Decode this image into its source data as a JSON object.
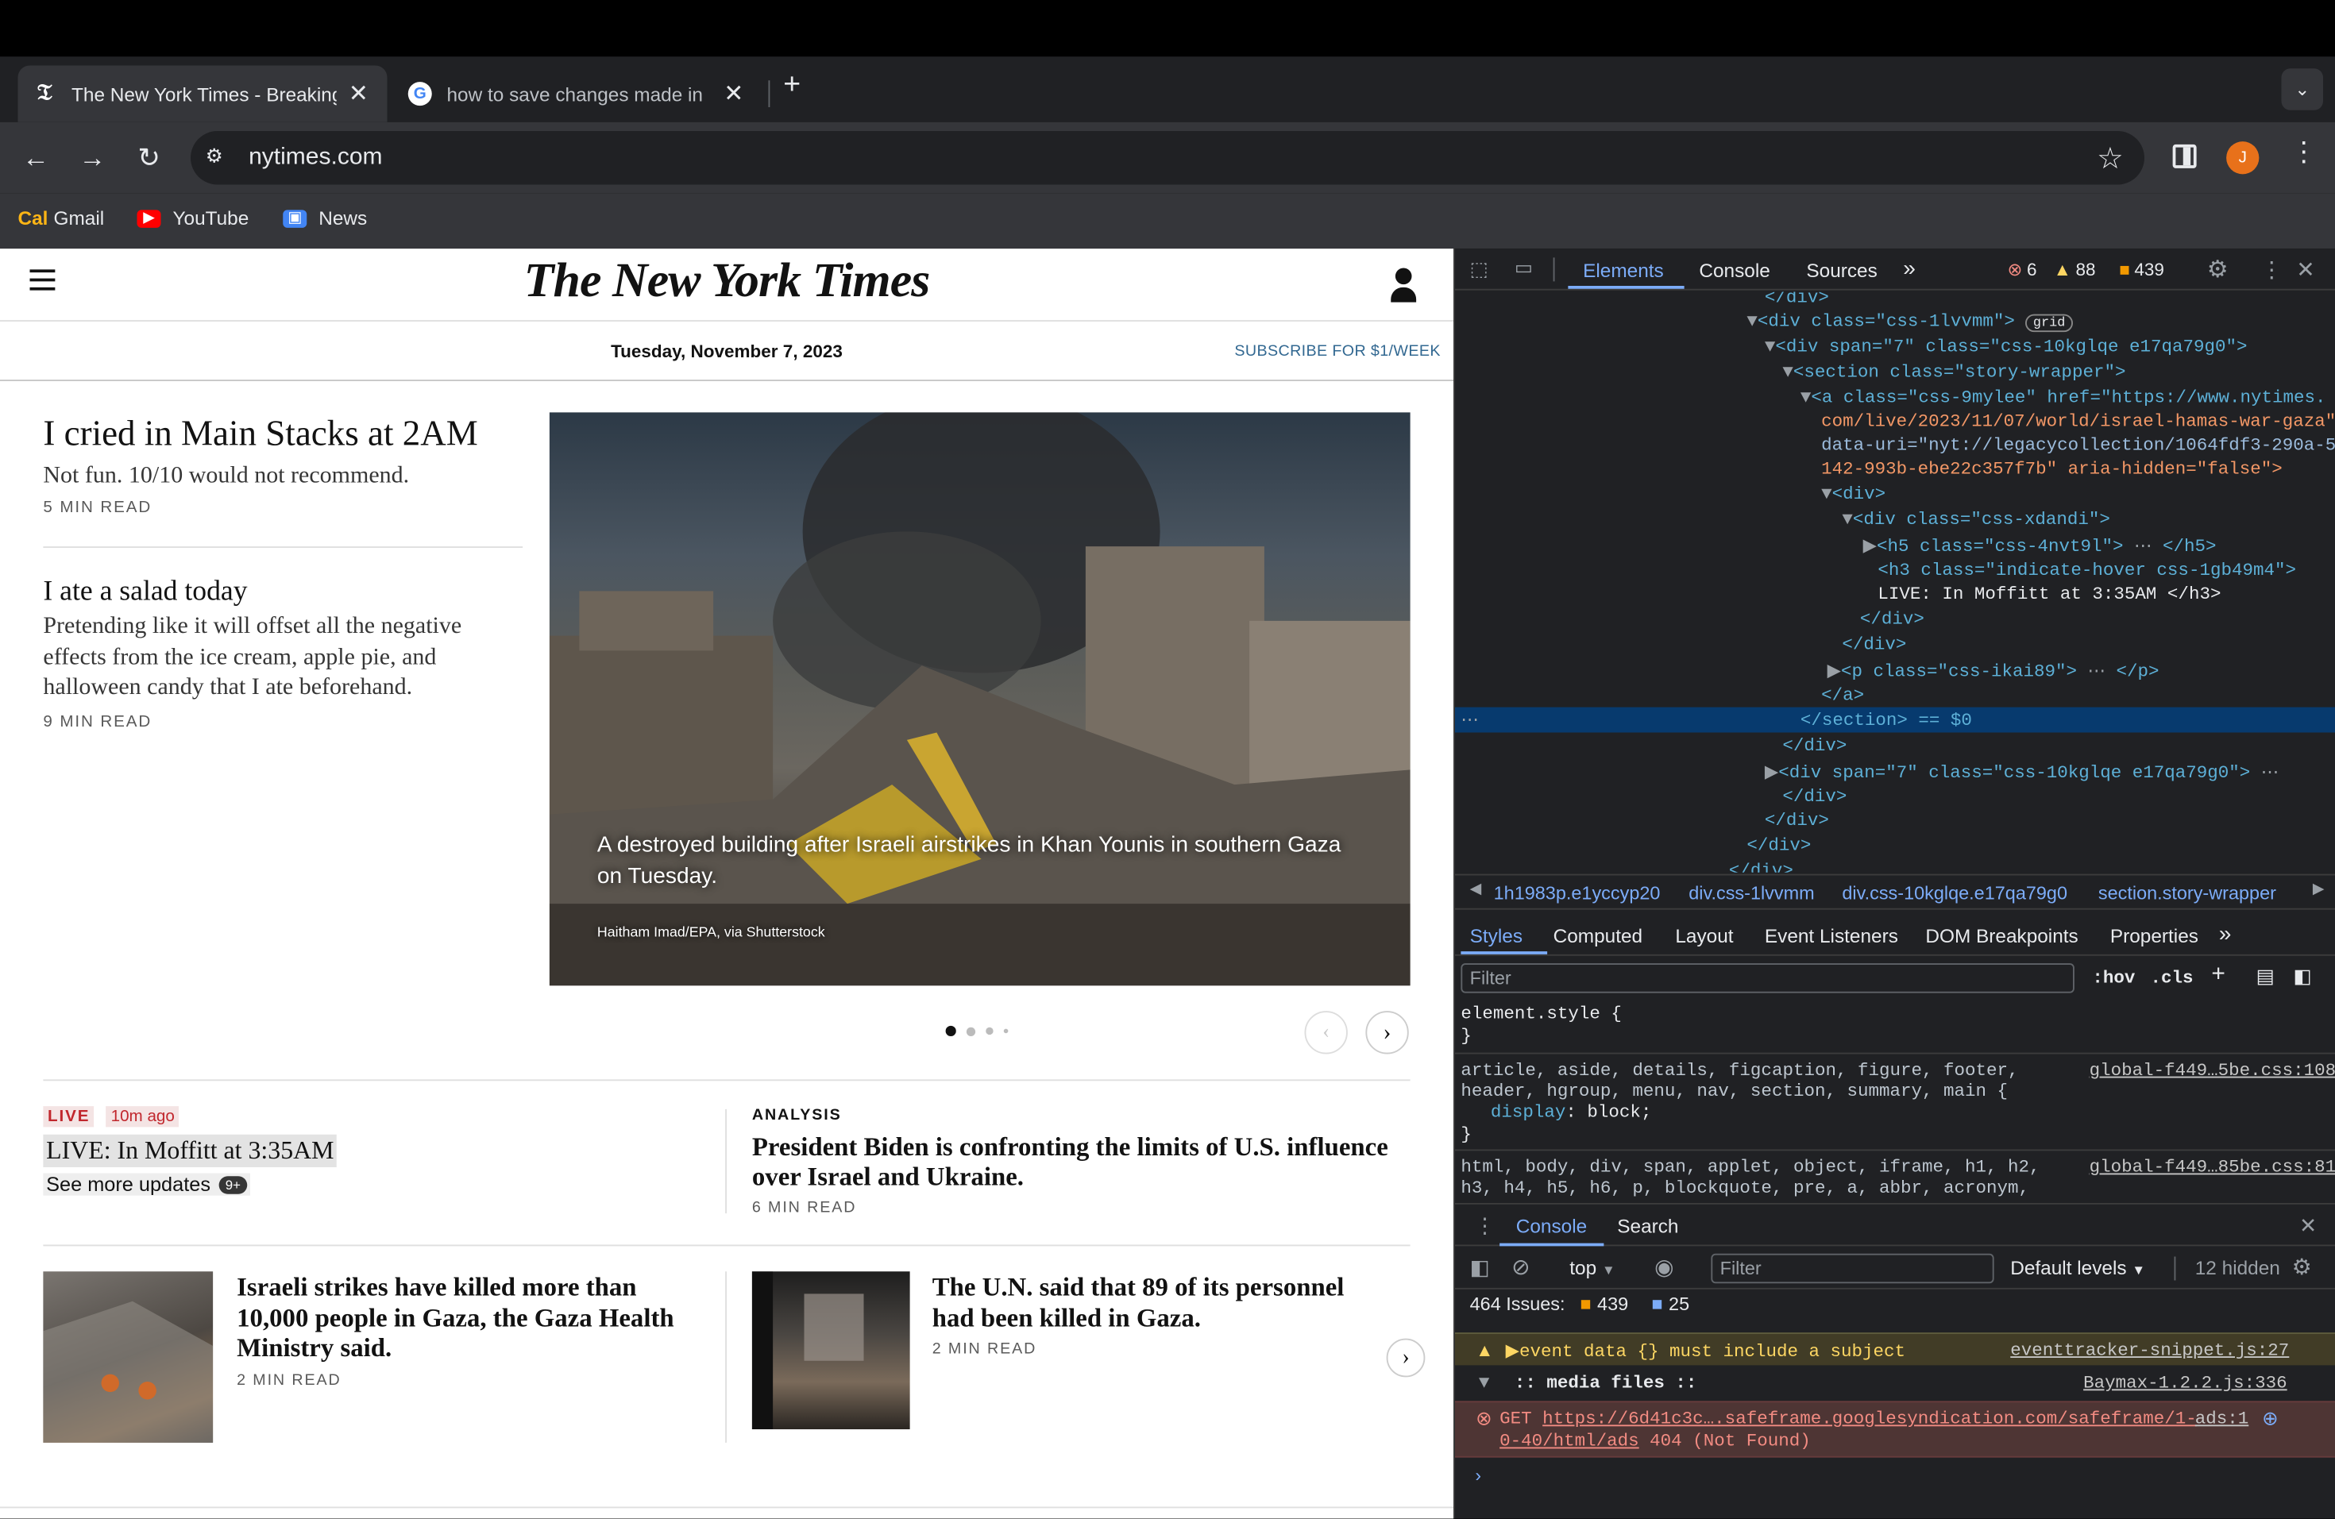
{
  "browser": {
    "tabs": [
      {
        "title": "The New York Times - Breaking",
        "active": true
      },
      {
        "title": "how to save changes made in",
        "active": false
      }
    ],
    "new_tab": "+",
    "url": "nytimes.com",
    "profile_initial": "J",
    "bookmarks": [
      {
        "label": "Gmail"
      },
      {
        "label": "YouTube"
      },
      {
        "label": "News"
      }
    ]
  },
  "nyt": {
    "logo": "The New York Times",
    "date": "Tuesday, November 7, 2023",
    "subscribe": "SUBSCRIBE FOR $1/WEEK",
    "story1": {
      "title": "I cried in Main Stacks at 2AM",
      "summary": "Not fun. 10/10 would not recommend.",
      "read": "5 MIN READ"
    },
    "story2": {
      "title": "I ate a salad today",
      "summary": "Pretending like it will offset all the negative effects from the ice cream, apple pie, and halloween candy that I ate beforehand.",
      "read": "9 MIN READ"
    },
    "hero": {
      "caption": "A destroyed building after Israeli airstrikes in Khan Younis in southern Gaza on Tuesday.",
      "credit": "Haitham Imad/EPA, via Shutterstock"
    },
    "live": {
      "badge": "LIVE",
      "ago": "10m ago",
      "title": "LIVE: In Moffitt at 3:35AM",
      "more": "See more updates",
      "count": "9+"
    },
    "analysis": {
      "kicker": "ANALYSIS",
      "title": "President Biden is confronting the limits of U.S. influence over Israel and Ukraine.",
      "read": "6 MIN READ"
    },
    "card1": {
      "title": "Israeli strikes have killed more than 10,000 people in Gaza, the Gaza Health Ministry said.",
      "read": "2 MIN READ"
    },
    "card2": {
      "title": "The U.N. said that 89 of its personnel had been killed in Gaza.",
      "read": "2 MIN READ"
    }
  },
  "devtools": {
    "tabs": [
      "Elements",
      "Console",
      "Sources"
    ],
    "errors": "6",
    "warnings": "88",
    "issues": "439",
    "dom": [
      "</div>",
      "<div class=\"css-1lvvmm\">",
      "<div span=\"7\" class=\"css-10kglqe e17qa79g0\">",
      "<section class=\"story-wrapper\">",
      "<a class=\"css-9mylee\" href=\"https://www.nytimes.",
      "com/live/2023/11/07/world/israel-hamas-war-gaza\"",
      "data-uri=\"nyt://legacycollection/1064fdf3-290a-5",
      "142-993b-ebe22c357f7b\" aria-hidden=\"false\">",
      "<div>",
      "<div class=\"css-xdandi\">",
      "<h5 class=\"css-4nvt9l\">",
      "<h3 class=\"indicate-hover css-1gb49m4\">",
      "LIVE: In Moffitt at 3:35AM </h3>",
      "</div>",
      "</div>",
      "<p class=\"css-ikai89\">",
      "</a>",
      "</section> == $0",
      "</div>",
      "<div span=\"7\" class=\"css-10kglqe e17qa79g0\">",
      "</div>",
      "</div>",
      "</div>",
      "</div>"
    ],
    "grid_badge": "grid",
    "breadcrumbs": [
      "1h1983p.e1yccyp20",
      "div.css-1lvvmm",
      "div.css-10kglqe.e17qa79g0",
      "section.story-wrapper"
    ],
    "style_tabs": [
      "Styles",
      "Computed",
      "Layout",
      "Event Listeners",
      "DOM Breakpoints",
      "Properties"
    ],
    "filter_placeholder": "Filter",
    "hov": ":hov",
    "cls": ".cls",
    "rules": [
      {
        "sel": "element.style {",
        "body": "}",
        "src": ""
      },
      {
        "sel": "article, aside, details, figcaption, figure, footer,",
        "sel2": "header, hgroup, menu, nav, section, summary, main {",
        "prop": "display",
        "val": "block;",
        "src": "global-f449…5be.css:108"
      },
      {
        "sel": "html, body, div, span, applet, object, iframe, h1, h2,",
        "sel2": "h3, h4, h5, h6, p, blockquote, pre, a, abbr, acronym,",
        "src": "global-f449…85be.css:81"
      }
    ],
    "drawer_tabs": [
      "Console",
      "Search"
    ],
    "context": "top",
    "console_filter": "Filter",
    "levels": "Default levels",
    "hidden": "12 hidden",
    "issues_label": "464 Issues:",
    "issue_warn": "439",
    "issue_info": "25",
    "console": [
      {
        "type": "warn",
        "text": "event data {} must include a subject",
        "src": "eventtracker-snippet.js:27"
      },
      {
        "type": "group",
        "text": ":: media files ::",
        "src": "Baymax-1.2.2.js:336"
      },
      {
        "type": "error",
        "method": "GET",
        "url": "https://6d41c3c….safeframe.googlesyndication.com/safeframe/1-",
        "url2": "0-40/html/ads",
        "status": "404 (Not Found)",
        "src": "ads:1"
      }
    ]
  }
}
